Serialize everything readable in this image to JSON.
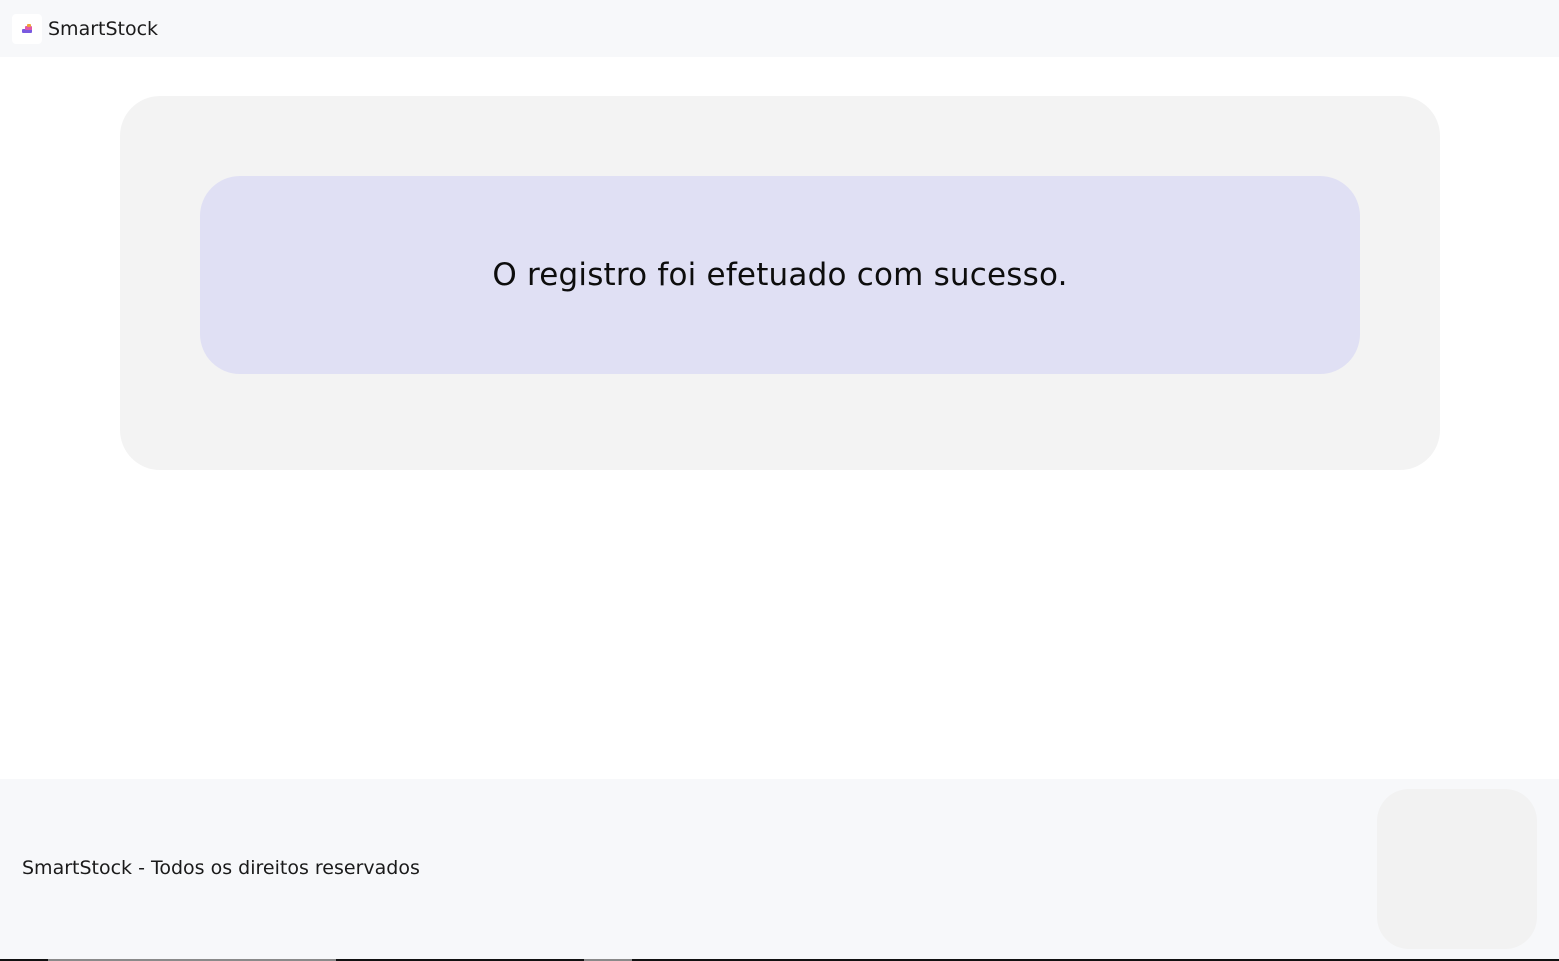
{
  "header": {
    "brand_name": "SmartStock",
    "logo_icon": "smartstock-logo-icon",
    "logo_colors": [
      "#e05aa8",
      "#8a5ae0",
      "#f0c23a"
    ]
  },
  "main": {
    "message": "O registro foi efetuado com sucesso.",
    "message_bg": "#e0e0f4",
    "card_bg": "#f3f3f3"
  },
  "footer": {
    "copyright": "SmartStock - Todos os direitos reservados",
    "bg": "#f7f8fa"
  }
}
